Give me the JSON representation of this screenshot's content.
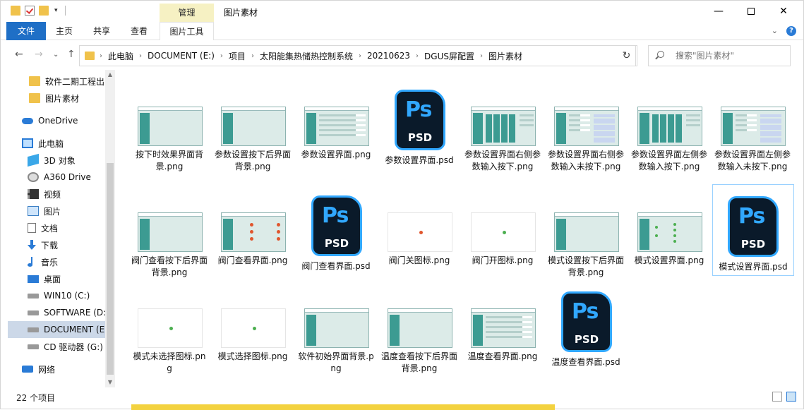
{
  "title_bar": {
    "manage_tab": "管理",
    "window_title": "图片素材"
  },
  "ribbon": {
    "file": "文件",
    "home": "主页",
    "share": "共享",
    "view": "查看",
    "picture_tools": "图片工具"
  },
  "breadcrumbs": [
    "此电脑",
    "DOCUMENT (E:)",
    "项目",
    "太阳能集热储热控制系统",
    "20210623",
    "DGUS屏配置",
    "图片素材"
  ],
  "search": {
    "placeholder": "搜索\"图片素材\""
  },
  "nav": {
    "items": [
      {
        "label": "软件二期工程出图",
        "icon": "folder-icon"
      },
      {
        "label": "图片素材",
        "icon": "folder-icon"
      },
      {
        "label": "OneDrive",
        "icon": "onedrive-icon"
      },
      {
        "label": "此电脑",
        "icon": "pc-icon"
      },
      {
        "label": "3D 对象",
        "icon": "3d-objects-icon"
      },
      {
        "label": "A360 Drive",
        "icon": "a360-drive-icon"
      },
      {
        "label": "视频",
        "icon": "video-icon"
      },
      {
        "label": "图片",
        "icon": "pictures-icon"
      },
      {
        "label": "文档",
        "icon": "documents-icon"
      },
      {
        "label": "下载",
        "icon": "downloads-icon"
      },
      {
        "label": "音乐",
        "icon": "music-icon"
      },
      {
        "label": "桌面",
        "icon": "desktop-icon"
      },
      {
        "label": "WIN10 (C:)",
        "icon": "drive-icon"
      },
      {
        "label": "SOFTWARE (D:)",
        "icon": "drive-icon"
      },
      {
        "label": "DOCUMENT (E:)",
        "icon": "drive-icon"
      },
      {
        "label": "CD 驱动器 (G:)",
        "icon": "cd-drive-icon"
      },
      {
        "label": "网络",
        "icon": "network-icon"
      }
    ]
  },
  "files": [
    {
      "name": "按下时效果界面背景.png",
      "kind": "ui"
    },
    {
      "name": "参数设置按下后界面背景.png",
      "kind": "ui"
    },
    {
      "name": "参数设置界面.png",
      "kind": "ui-rows"
    },
    {
      "name": "参数设置界面.psd",
      "kind": "psd"
    },
    {
      "name": "参数设置界面右侧参数输入按下.png",
      "kind": "ui-grid"
    },
    {
      "name": "参数设置界面右侧参数输入未按下.png",
      "kind": "ui-keypad"
    },
    {
      "name": "参数设置界面左侧参数输入按下.png",
      "kind": "ui-grid"
    },
    {
      "name": "参数设置界面左侧参数输入未按下.png",
      "kind": "ui-keypad"
    },
    {
      "name": "阀门查看按下后界面背景.png",
      "kind": "ui"
    },
    {
      "name": "阀门查看界面.png",
      "kind": "ui-dots"
    },
    {
      "name": "阀门查看界面.psd",
      "kind": "psd"
    },
    {
      "name": "阀门关图标.png",
      "kind": "icon-red"
    },
    {
      "name": "阀门开图标.png",
      "kind": "icon-green"
    },
    {
      "name": "模式设置按下后界面背景.png",
      "kind": "ui"
    },
    {
      "name": "模式设置界面.png",
      "kind": "ui-greendots"
    },
    {
      "name": "模式设置界面.psd",
      "kind": "psd"
    },
    {
      "name": "模式未选择图标.png",
      "kind": "icon-green"
    },
    {
      "name": "模式选择图标.png",
      "kind": "icon-green"
    },
    {
      "name": "软件初始界面背景.png",
      "kind": "ui"
    },
    {
      "name": "温度查看按下后界面背景.png",
      "kind": "ui"
    },
    {
      "name": "温度查看界面.png",
      "kind": "ui-rows"
    },
    {
      "name": "温度查看界面.psd",
      "kind": "psd"
    }
  ],
  "psd_label": {
    "ps": "Ps",
    "psd": "PSD"
  },
  "status": {
    "count": "22 个项目"
  },
  "colors": {
    "accent": "#1f6fc6",
    "selection": "#ccd8e8",
    "manage_tab": "#f6f1c3",
    "psd_blue": "#31a8ff"
  }
}
